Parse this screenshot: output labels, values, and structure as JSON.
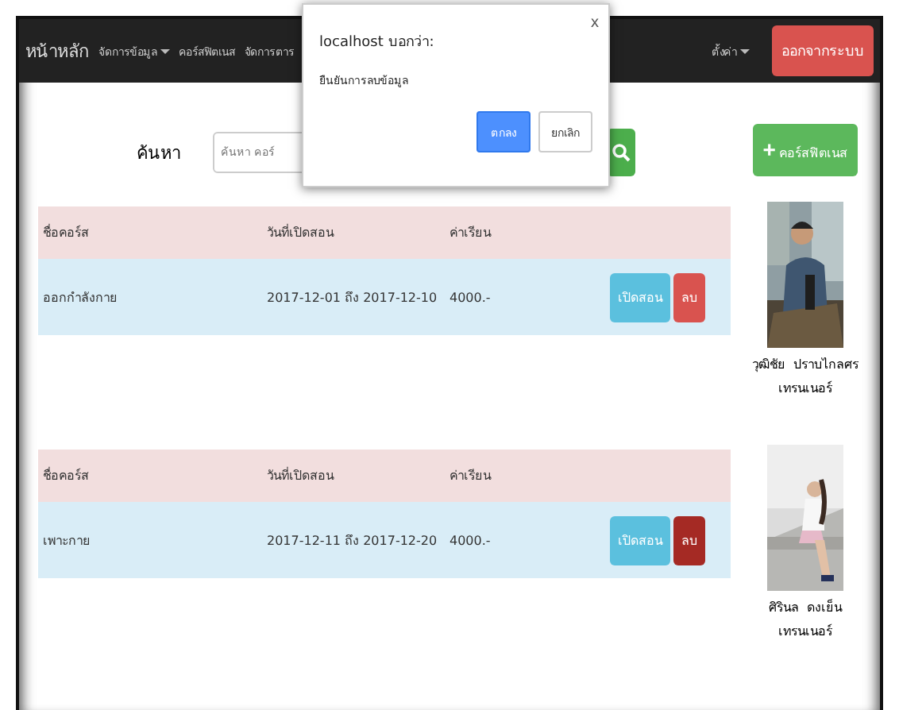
{
  "navbar": {
    "brand": "หน้าหลัก",
    "items": [
      {
        "label": "จัดการข้อมูล",
        "dropdown": true
      },
      {
        "label": "คอร์สฟิตเนส",
        "dropdown": false
      },
      {
        "label": "จัดการตาร",
        "dropdown": false
      }
    ],
    "right_items": [
      {
        "label": "ตั้งค่า",
        "dropdown": true
      }
    ],
    "logout": "ออกจากระบบ"
  },
  "dialog": {
    "title": "localhost บอกว่า:",
    "message": "ยืนยันการลบข้อมูล",
    "close": "x",
    "buttons": [
      {
        "label": "ตกลง",
        "kind": "primary"
      },
      {
        "label": "ยกเลิก",
        "kind": "default"
      }
    ]
  },
  "search": {
    "label": "ค้นหา",
    "placeholder": "ค้นหา คอร์"
  },
  "add_button": {
    "icon": "+",
    "label": "คอร์สฟิตเนส"
  },
  "courses": [
    {
      "columns": [
        "ชื่อคอร์ส",
        "วันที่เปิดสอน",
        "ค่าเรียน"
      ],
      "cells": [
        "ออกกำลังกาย",
        "2017-12-01  ถึง  2017-12-10",
        "4000.-"
      ],
      "actions": [
        {
          "label": "เปิดสอน",
          "kind": "info",
          "pressed": false
        },
        {
          "label": "ลบ",
          "kind": "danger",
          "pressed": false
        }
      ],
      "trainer": {
        "name": "วุฒิชัย  ปราบไกลศร",
        "role": "เทรนเนอร์",
        "kind": "picture"
      }
    },
    {
      "columns": [
        "ชื่อคอร์ส",
        "วันที่เปิดสอน",
        "ค่าเรียน"
      ],
      "cells": [
        "เพาะกาย",
        "2017-12-11  ถึง  2017-12-20",
        "4000.-"
      ],
      "actions": [
        {
          "label": "เปิดสอน",
          "kind": "info",
          "pressed": false
        },
        {
          "label": "ลบ",
          "kind": "danger",
          "pressed": true
        }
      ],
      "trainer": {
        "name": "ศิรินล  ดงเย็น",
        "role": "เทรนเนอร์",
        "kind": "picture"
      }
    }
  ]
}
